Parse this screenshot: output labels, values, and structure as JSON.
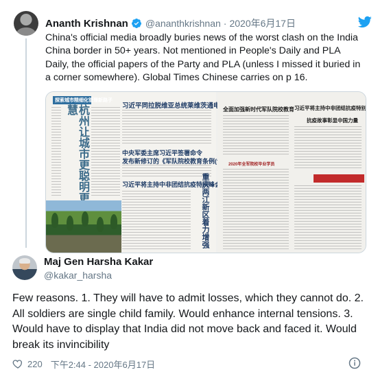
{
  "quoted_tweet": {
    "name": "Ananth Krishnan",
    "handle": "@ananthkrishnan",
    "separator": "·",
    "date": "2020年6月17日",
    "text": "China's official media broadly buries news of the worst clash on the India China border in 50+ years. Not mentioned in People's Daily and PLA Daily, the official papers of the Party and PLA (unless I missed it buried in a corner somewhere). Global Times Chinese carries on p 16.",
    "verified_icon": "verified-badge-icon",
    "bird_icon": "twitter-bird-icon",
    "accent_color": "#1da1f2",
    "media": {
      "paper1": {
        "banner": "探索城市精细化管理新路子",
        "vertical_headline": "杭州让城市更聪明更智慧",
        "headline_1": "习近平同拉脱维亚总统莱维茨通电话",
        "headline_2": "中央军委主席习近平签署命令",
        "headline_2b": "发布新修订的《军队院校教育条例(试行)》",
        "headline_3": "习近平将主持中非团结抗疫特别峰会",
        "side_vertical": "重庆两江新区着力增强",
        "side_label": "学习贯彻"
      },
      "paper2": {
        "headline_a": "全面加强新时代军队院校教育",
        "headline_b": "习近平将主持中非团结抗疫特别峰会",
        "headline_c": "抗疫故事彰显中国力量",
        "caption": "2020年全军院校毕业学员"
      }
    }
  },
  "main_tweet": {
    "name": "Maj Gen Harsha Kakar",
    "handle": "@kakar_harsha",
    "text": "Few reasons. 1. They will have to admit losses, which they cannot do. 2. All soldiers are single child family. Would enhance internal tensions. 3. Would have to display that India did not move back and faced it. Would break its invincibility",
    "likes": "220",
    "timestamp": "下午2:44 - 2020年6月17日",
    "heart_icon": "heart-icon",
    "info_icon": "info-icon"
  }
}
